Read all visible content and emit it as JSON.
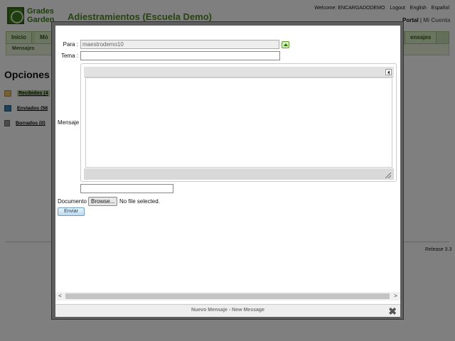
{
  "app": {
    "logo_line1": "Grades",
    "logo_line2": "Garden",
    "title": "Adiestramientos (Escuela Demo)"
  },
  "top_links": {
    "welcome": "Welcome: ENCARGADODEMO",
    "logout": "Logout",
    "english": "English",
    "espanol": "Español"
  },
  "portal_links": {
    "portal": "Portal",
    "separator": "|",
    "mi_cuenta": "Mi Cuenta"
  },
  "nav": {
    "tabs": [
      {
        "label": "Inicio"
      },
      {
        "label": "Mó"
      },
      {
        "label": "ensajes"
      }
    ],
    "subnav_item": "Mensajes"
  },
  "sidebar": {
    "heading": "Opciones",
    "items": [
      {
        "label": "Recibidos (4",
        "icon": "folder-icon"
      },
      {
        "label": "Enviados (58",
        "icon": "sent-icon"
      },
      {
        "label": "Borrados (0)",
        "icon": "trash-icon"
      }
    ]
  },
  "release": "Release 3.3",
  "modal": {
    "labels": {
      "para": "Para :",
      "tema": "Tema :",
      "mensaje": "Mensaje",
      "documento": "Documento"
    },
    "para_value": "maestrodemo10",
    "tema_value": "",
    "extra_value": "",
    "browse_label": "Browse...",
    "file_status": "No file selected.",
    "send_label": "Enviar",
    "footer_title": "Nuevo Mensaje - New Message",
    "close_glyph": "✖",
    "scroll_left": "<",
    "scroll_right": ">"
  },
  "colors": {
    "brand_green": "#4d8a1f",
    "nav_bg": "#c9dfb2",
    "overlay": "rgba(0,0,0,0.5)",
    "send_button": "#bcd9ee"
  }
}
